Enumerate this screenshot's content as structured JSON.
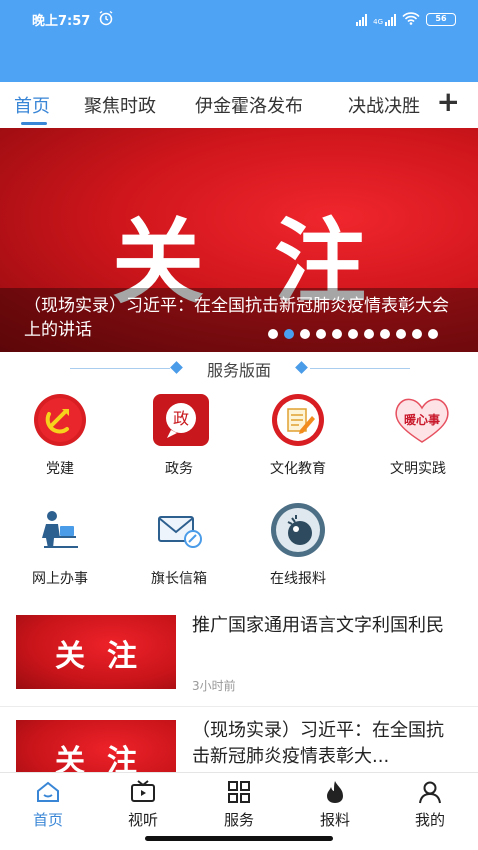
{
  "status_bar": {
    "time": "晚上7:57",
    "battery": "56",
    "network": "4G"
  },
  "tabs": [
    {
      "label": "首页",
      "active": true
    },
    {
      "label": "聚焦时政"
    },
    {
      "label": "伊金霍洛发布"
    },
    {
      "label": "决战决胜"
    }
  ],
  "tabs_add_icon": "plus-icon",
  "banner": {
    "title": "关注",
    "caption": "（现场实录）习近平：在全国抗击新冠肺炎疫情表彰大会上的讲话",
    "slide_count": 11,
    "active_slide": 2
  },
  "services": {
    "title": "服务版面",
    "items": [
      {
        "label": "党建",
        "icon": "party-emblem-icon"
      },
      {
        "label": "政务",
        "icon": "government-icon",
        "badge": "政"
      },
      {
        "label": "文化教育",
        "icon": "education-icon"
      },
      {
        "label": "文明实践",
        "icon": "warm-heart-icon",
        "badge": "暖心事"
      },
      {
        "label": "网上办事",
        "icon": "online-service-icon"
      },
      {
        "label": "旗长信箱",
        "icon": "mailbox-icon"
      },
      {
        "label": "在线报料",
        "icon": "report-icon"
      }
    ]
  },
  "news": [
    {
      "thumb": "关注",
      "title": "推广国家通用语言文字利国利民",
      "time": "3小时前"
    },
    {
      "thumb": "关注",
      "title": "（现场实录）习近平：在全国抗击新冠肺炎疫情表彰大...",
      "time": ""
    }
  ],
  "bottom_nav": [
    {
      "label": "首页",
      "icon": "home-icon",
      "active": true
    },
    {
      "label": "视听",
      "icon": "tv-icon"
    },
    {
      "label": "服务",
      "icon": "grid-icon"
    },
    {
      "label": "报料",
      "icon": "fire-icon"
    },
    {
      "label": "我的",
      "icon": "user-icon"
    }
  ],
  "colors": {
    "accent": "#3a86d6",
    "status_bar": "#4fa3f5",
    "banner_red": "#d0161c"
  }
}
